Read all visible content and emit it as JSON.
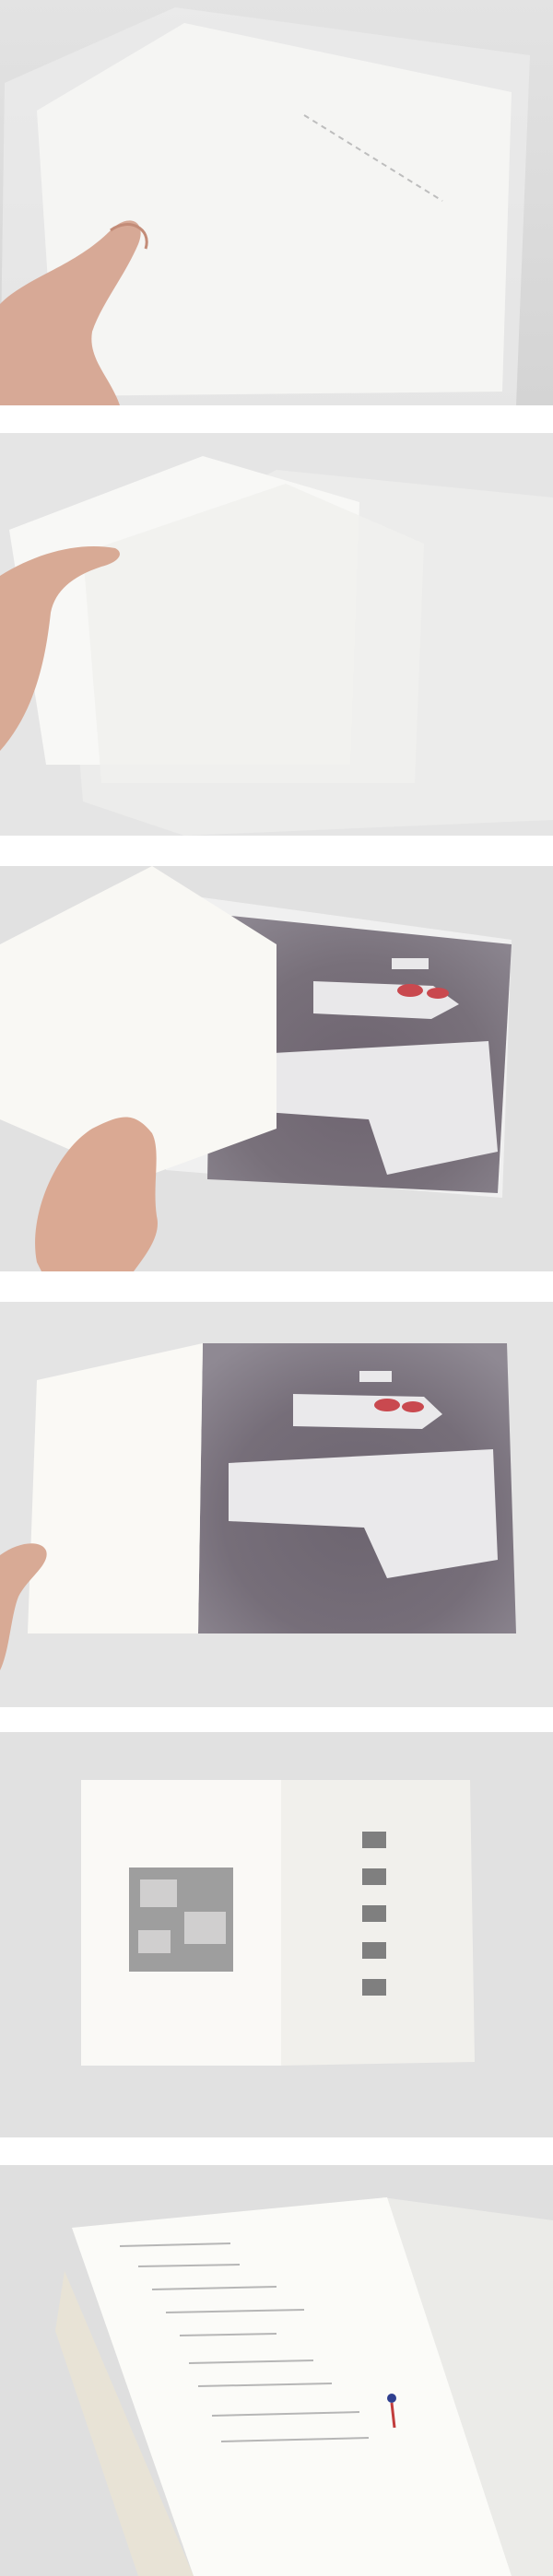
{
  "photos": [
    {
      "id": "photo-1",
      "subject": "hand-holding-book-in-translucent-sleeve"
    },
    {
      "id": "photo-2",
      "subject": "hand-sliding-book-out-of-sleeve"
    },
    {
      "id": "photo-3",
      "subject": "hand-opening-cover-to-mottled-purple-page"
    },
    {
      "id": "photo-4",
      "subject": "book-open-to-mottled-purple-page"
    },
    {
      "id": "photo-5",
      "subject": "open-spread-with-collage-and-thumbnail-column"
    },
    {
      "id": "photo-6",
      "subject": "colophon-text-page-angled"
    }
  ],
  "colors": {
    "background": "#ececea",
    "paper": "#f7f6f1",
    "mottled_page": "#6f6570",
    "tape": "#e9e8ea",
    "red_marks": "#c9494f"
  }
}
